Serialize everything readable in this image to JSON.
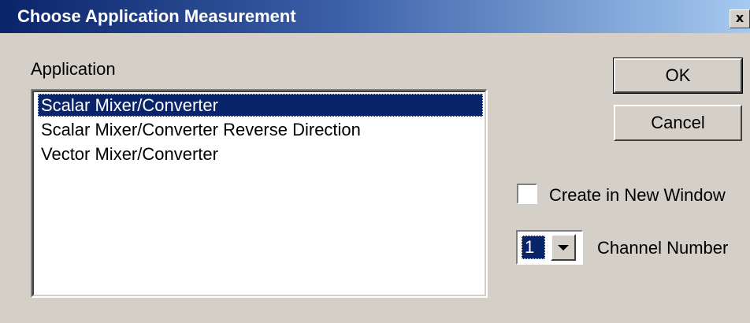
{
  "window": {
    "title": "Choose Application Measurement",
    "close_glyph": "x"
  },
  "application": {
    "label": "Application",
    "items": [
      {
        "label": "Scalar Mixer/Converter",
        "selected": true
      },
      {
        "label": "Scalar Mixer/Converter Reverse Direction",
        "selected": false
      },
      {
        "label": "Vector Mixer/Converter",
        "selected": false
      }
    ]
  },
  "buttons": {
    "ok_label": "OK",
    "cancel_label": "Cancel"
  },
  "options": {
    "create_new_window_label": "Create in New Window",
    "create_new_window_checked": false,
    "channel_number_label": "Channel Number",
    "channel_number_value": "1"
  },
  "colors": {
    "dialog_face": "#d4d0c8",
    "title_bar_start": "#0a246a",
    "title_bar_end": "#a6caf0",
    "selection": "#0a246a"
  }
}
